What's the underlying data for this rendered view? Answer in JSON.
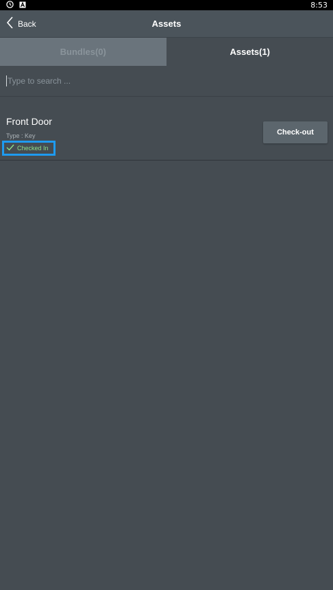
{
  "status_bar": {
    "time": "8:53",
    "icons": [
      "clock-icon",
      "a-badge-icon"
    ]
  },
  "app_bar": {
    "back_label": "Back",
    "title": "Assets"
  },
  "tabs": [
    {
      "label": "Bundles(0)",
      "active": false
    },
    {
      "label": "Assets(1)",
      "active": true
    }
  ],
  "search": {
    "placeholder": "Type to search ...",
    "value": ""
  },
  "assets": [
    {
      "name": "Front Door",
      "type": "Type : Key",
      "status": "Checked In",
      "action_label": "Check-out"
    }
  ],
  "colors": {
    "background": "#454c52",
    "appbar": "#4b545b",
    "inactive_tab": "#6a747c",
    "status_green": "#8de08a",
    "highlight_blue": "#1e9bf0"
  }
}
